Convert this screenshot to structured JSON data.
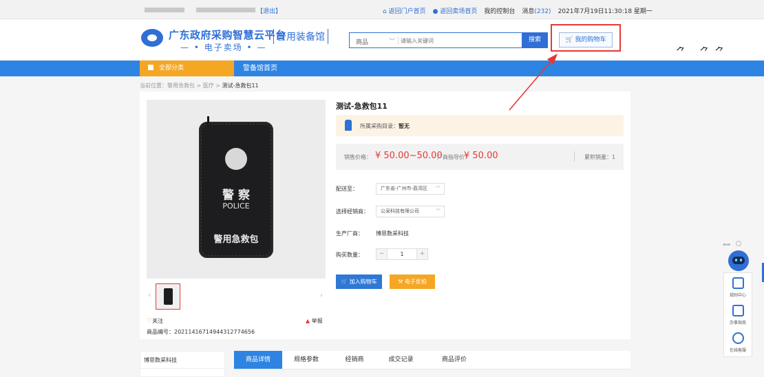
{
  "topbar": {
    "logout": "【退出】",
    "links": [
      {
        "label": "返回门户首页",
        "icon": "home-icon"
      },
      {
        "label": "返回卖场首页",
        "icon": "location-icon"
      },
      {
        "label": "我的控制台"
      }
    ],
    "message_label": "消息",
    "message_count": "(232)",
    "datetime": "2021年7月19日11:30:18 星期一"
  },
  "header": {
    "brand_main": "广东政府采购智慧云平台",
    "brand_sub": "电子卖场",
    "brand_tag": "警用装备馆",
    "search_category": "商品",
    "search_placeholder": "请输入关键词",
    "search_button": "搜索",
    "cart_button": "我的购物车"
  },
  "nav": {
    "all_categories": "全部分类",
    "home": "警备馆首页"
  },
  "breadcrumb": {
    "prefix": "当前位置：警用急救包 > 医疗 > ",
    "current": "测试-急救包11"
  },
  "product": {
    "title": "测试-急救包11",
    "image_text": {
      "line1": "警 察",
      "line2": "POLICE",
      "line3": "警用急救包"
    },
    "catalog_label": "所属采购目录：",
    "catalog_value": "暂无",
    "price_label": "销售价格：",
    "price_value": "¥ 50.00~50.00",
    "guide_label": "厂商指导价：",
    "guide_value": "¥ 50.00",
    "sales_label": "累积销量：1",
    "deliver_label": "配送至：",
    "deliver_value": "广东省-广州市-荔湾区",
    "dealer_label": "选择经销商：",
    "dealer_value": "公采科技有限公司",
    "maker_label": "生产厂商：",
    "maker_value": "博思数采科技",
    "qty_label": "购买数量：",
    "qty_value": "1",
    "add_cart": "加入购物车",
    "react": "电子反拍",
    "follow": "关注",
    "report": "举报",
    "code": "商品编号：20211416714944312774656"
  },
  "store": {
    "name": "博思数采科技"
  },
  "tabs": [
    "商品详情",
    "规格参数",
    "经销商",
    "成交记录",
    "商品评价"
  ],
  "sidepanel": {
    "items": [
      {
        "label": "规则中心",
        "icon": "book-icon"
      },
      {
        "label": "办事指南",
        "icon": "document-icon"
      },
      {
        "label": "在线客服",
        "icon": "headset-icon"
      }
    ]
  },
  "colors": {
    "brand_blue": "#2f6fd6",
    "nav_blue": "#2e84e2",
    "accent_orange": "#f5a623",
    "price_red": "#e53935"
  }
}
